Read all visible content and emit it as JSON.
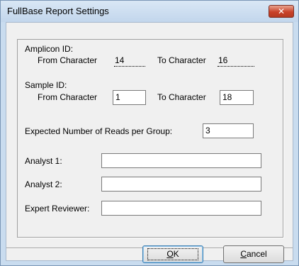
{
  "window": {
    "title": "FullBase Report Settings",
    "close_glyph": "✕"
  },
  "amplicon": {
    "heading": "Amplicon ID:",
    "from_label": "From Character",
    "from_value": "14",
    "to_label": "To Character",
    "to_value": "16"
  },
  "sample": {
    "heading": "Sample ID:",
    "from_label": "From Character",
    "from_value": "1",
    "to_label": "To Character",
    "to_value": "18"
  },
  "reads": {
    "label": "Expected Number of Reads per Group:",
    "value": "3"
  },
  "analyst1": {
    "label": "Analyst 1:",
    "value": ""
  },
  "analyst2": {
    "label": "Analyst 2:",
    "value": ""
  },
  "reviewer": {
    "label": "Expert Reviewer:",
    "value": ""
  },
  "buttons": {
    "ok_accel": "O",
    "ok_rest": "K",
    "cancel_accel": "C",
    "cancel_rest": "ancel"
  },
  "colors": {
    "titlebar": "#c9dcef",
    "close_button": "#c9422a",
    "client_bg": "#f0f0f0"
  }
}
